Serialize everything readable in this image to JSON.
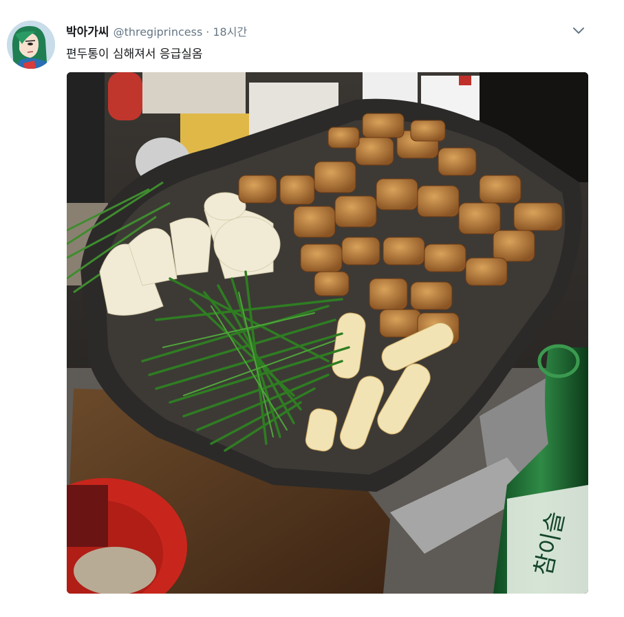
{
  "tweet": {
    "display_name": "박아가씨",
    "handle": "@thregiprincess",
    "separator": "·",
    "time": "18시간",
    "text": "편두통이 심해져서 응급실옴"
  },
  "media": {
    "bottle_label": "참이슬"
  },
  "icons": {
    "caret": "chevron-down-icon",
    "avatar": "anime-character-avatar"
  },
  "colors": {
    "text_primary": "#14171a",
    "text_secondary": "#657786"
  }
}
